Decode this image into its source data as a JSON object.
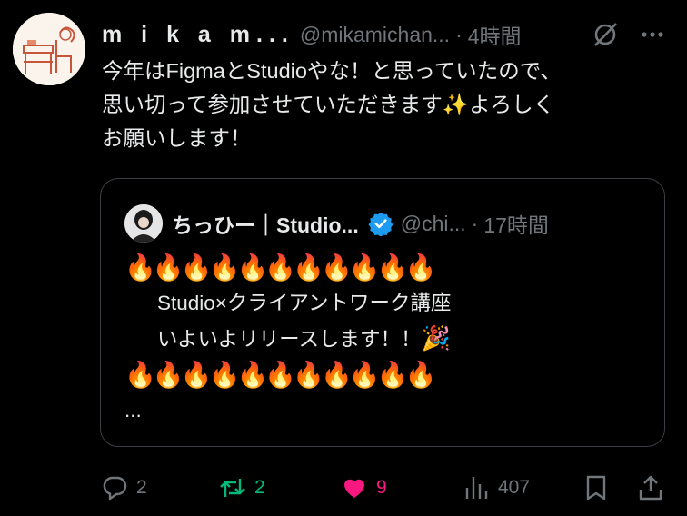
{
  "tweet": {
    "display_name": "m i k a m...",
    "handle": "@mikamichan...",
    "separator": "·",
    "time": "4時間",
    "text_lines": [
      "今年はFigmaとStudioやな！と思っていたので、",
      "思い切って参加させていただきます✨よろしく",
      "お願いします！"
    ]
  },
  "quote": {
    "display_name": "ちっひー｜Studio...",
    "handle": "@chi...",
    "separator": "·",
    "time": "17時間",
    "flames": "🔥🔥🔥🔥🔥🔥🔥🔥🔥🔥🔥",
    "line_1": "Studio×クライアントワーク講座",
    "line_2": "いよいよリリースします！！",
    "popper": "🎉",
    "ellipsis": "..."
  },
  "actions": {
    "reply_count": "2",
    "retweet_count": "2",
    "like_count": "9",
    "view_count": "407"
  },
  "colors": {
    "background": "#000000",
    "text": "#e7e9ea",
    "secondary": "#71767b",
    "retweet": "#00ba7c",
    "like": "#f91880",
    "verified": "#1d9bf0"
  }
}
